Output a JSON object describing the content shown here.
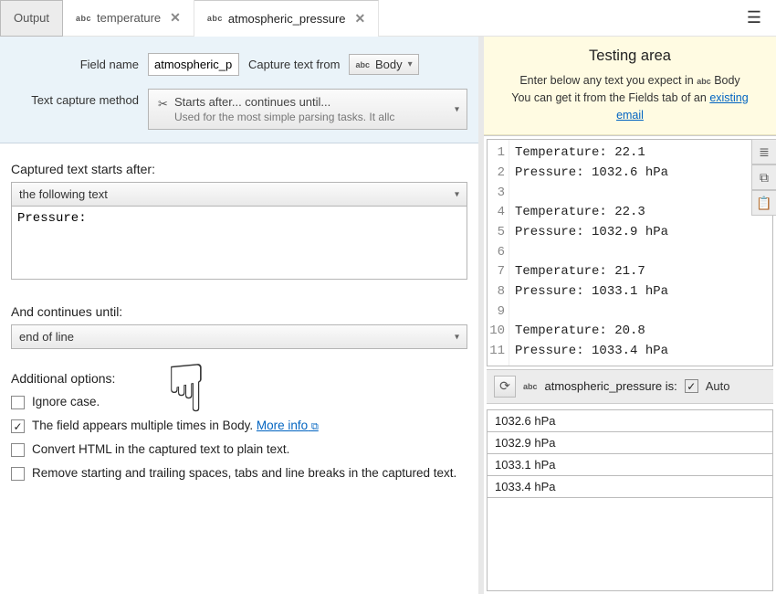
{
  "tabs": {
    "output": "Output",
    "temperature": "temperature",
    "pressure": "atmospheric_pressure"
  },
  "abc_label": "abc",
  "config": {
    "field_name_label": "Field name",
    "field_name_value": "atmospheric_p",
    "capture_from_label": "Capture text from",
    "capture_from_value": "Body",
    "method_label": "Text capture method",
    "method_title": "Starts after... continues until...",
    "method_sub": "Used for the most simple parsing tasks. It allc"
  },
  "starts": {
    "label": "Captured text starts after:",
    "mode": "the following text",
    "text": "Pressure:"
  },
  "until": {
    "label": "And continues until:",
    "mode": "end of line"
  },
  "options": {
    "label": "Additional options:",
    "ignore_case": "Ignore case.",
    "multi": "The field appears multiple times in Body.",
    "more_info": "More info",
    "convert_html": "Convert HTML in the captured text to plain text.",
    "trim": "Remove starting and trailing spaces, tabs and line breaks in the captured text."
  },
  "testing": {
    "title": "Testing area",
    "line1_a": "Enter below any text you expect in",
    "line1_b": "Body",
    "line2_a": "You can get it from the Fields tab of an",
    "line2_link": "existing email"
  },
  "editor": {
    "lines": [
      "Temperature: 22.1",
      "Pressure: 1032.6 hPa",
      "",
      "Temperature: 22.3",
      "Pressure: 1032.9 hPa",
      "",
      "Temperature: 21.7",
      "Pressure: 1033.1 hPa",
      "",
      "Temperature: 20.8",
      "Pressure: 1033.4 hPa"
    ]
  },
  "resultbar": {
    "field": "atmospheric_pressure",
    "suffix": "is:",
    "auto": "Auto"
  },
  "results": [
    "1032.6 hPa",
    "1032.9 hPa",
    "1033.1 hPa",
    "1033.4 hPa"
  ]
}
